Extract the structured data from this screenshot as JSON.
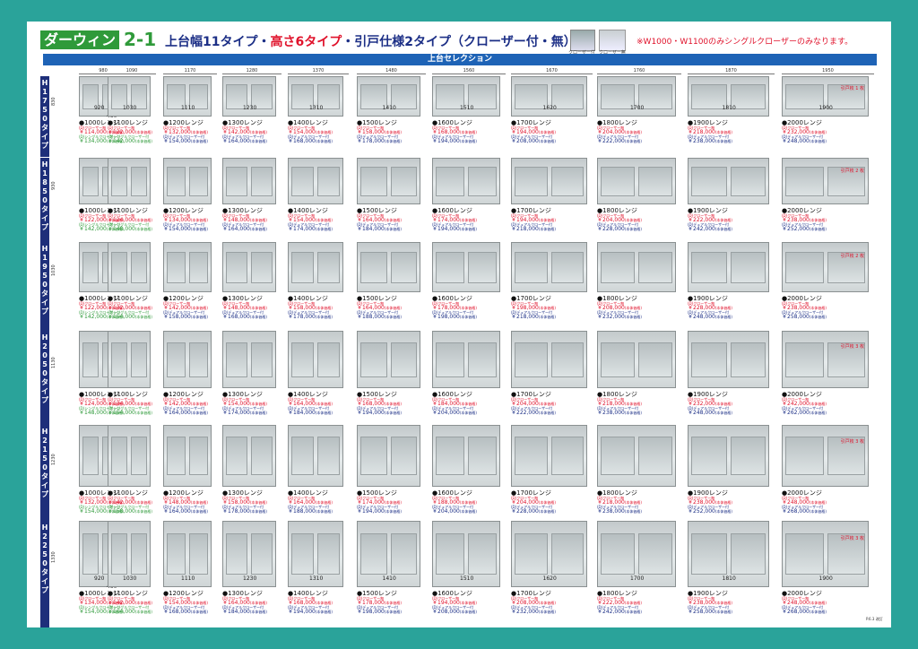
{
  "header": {
    "brand": "ダーウィン",
    "brand_number": "2-1",
    "headline_part1": "上台幅11タイプ・",
    "headline_part2": "高さ6タイプ",
    "headline_part3": "・引戸仕様2タイプ（クローザー付・無）",
    "thumb_label_1": "クローザー付",
    "thumb_label_2": "クローザー無",
    "note": "※W1000・W1100のみシングルクローザーのみなります。",
    "section_title": "上台セレクション"
  },
  "widths": [
    "980",
    "1090",
    "1170",
    "1280",
    "1370",
    "1480",
    "1560",
    "1670",
    "1760",
    "1870",
    "1950"
  ],
  "inner_widths": [
    "920",
    "1030",
    "1110",
    "1230",
    "1310",
    "1410",
    "1510",
    "1620",
    "1700",
    "1810",
    "1900"
  ],
  "inner_height": "450",
  "models": [
    "●1000レンジ",
    "●1100レンジ",
    "●1200レンジ",
    "●1300レンジ",
    "●1400レンジ",
    "●1500レンジ",
    "●1600レンジ",
    "●1700レンジ",
    "●1800レンジ",
    "●1900レンジ",
    "●2000レンジ"
  ],
  "labels": {
    "no_closer": "(D)クローザー無",
    "closer_single": "(D)シングルクローザー付",
    "closer_dual": "(D)デュアルクローザー付",
    "tax": "(本体価格)"
  },
  "types": [
    {
      "name": "H1750タイプ",
      "height": "830",
      "doors_note": "引戸枚 1 枚",
      "p1": [
        "114,000",
        "122,000",
        "132,000",
        "142,000",
        "154,000",
        "158,000",
        "168,000",
        "194,000",
        "204,000",
        "218,000",
        "232,000"
      ],
      "p2": [
        "134,000",
        "142,000",
        "154,000",
        "164,000",
        "168,000",
        "178,000",
        "194,000",
        "208,000",
        "222,000",
        "238,000",
        "248,000"
      ]
    },
    {
      "name": "H1850タイプ",
      "height": "930",
      "doors_note": "引戸枚 2 枚",
      "p1": [
        "122,000",
        "124,000",
        "134,000",
        "148,000",
        "154,000",
        "164,000",
        "174,000",
        "194,000",
        "204,000",
        "222,000",
        "238,000"
      ],
      "p2": [
        "142,000",
        "148,000",
        "154,000",
        "164,000",
        "174,000",
        "184,000",
        "194,000",
        "218,000",
        "228,000",
        "242,000",
        "252,000"
      ]
    },
    {
      "name": "H1950タイプ",
      "height": "1030",
      "doors_note": "引戸枚 2 枚",
      "p1": [
        "122,000",
        "132,000",
        "142,000",
        "148,000",
        "158,000",
        "164,000",
        "178,000",
        "198,000",
        "208,000",
        "228,000",
        "238,000"
      ],
      "p2": [
        "142,000",
        "154,000",
        "158,000",
        "168,000",
        "178,000",
        "188,000",
        "198,000",
        "218,000",
        "232,000",
        "248,000",
        "258,000"
      ]
    },
    {
      "name": "H2050タイプ",
      "height": "1130",
      "doors_note": "引戸枚 3 枚",
      "p1": [
        "124,000",
        "134,000",
        "142,000",
        "154,000",
        "164,000",
        "168,000",
        "184,000",
        "204,000",
        "218,000",
        "232,000",
        "242,000"
      ],
      "p2": [
        "148,000",
        "154,000",
        "164,000",
        "174,000",
        "184,000",
        "194,000",
        "204,000",
        "222,000",
        "238,000",
        "248,000",
        "262,000"
      ]
    },
    {
      "name": "H2150タイプ",
      "height": "1230",
      "doors_note": "引戸枚 3 枚",
      "p1": [
        "132,000",
        "142,000",
        "148,000",
        "158,000",
        "164,000",
        "174,000",
        "188,000",
        "204,000",
        "218,000",
        "238,000",
        "248,000"
      ],
      "p2": [
        "154,000",
        "158,000",
        "164,000",
        "178,000",
        "188,000",
        "194,000",
        "204,000",
        "228,000",
        "238,000",
        "252,000",
        "268,000"
      ]
    },
    {
      "name": "H2250タイプ",
      "height": "1330",
      "doors_note": "引戸枚 3 枚",
      "p1": [
        "134,000",
        "142,000",
        "154,000",
        "164,000",
        "168,000",
        "178,000",
        "194,000",
        "208,000",
        "222,000",
        "238,000",
        "248,000"
      ],
      "p2": [
        "154,000",
        "164,000",
        "168,000",
        "184,000",
        "194,000",
        "198,000",
        "208,000",
        "232,000",
        "242,000",
        "258,000",
        "268,000"
      ]
    }
  ],
  "currency": "￥",
  "footer": "P.6.3 改訂"
}
